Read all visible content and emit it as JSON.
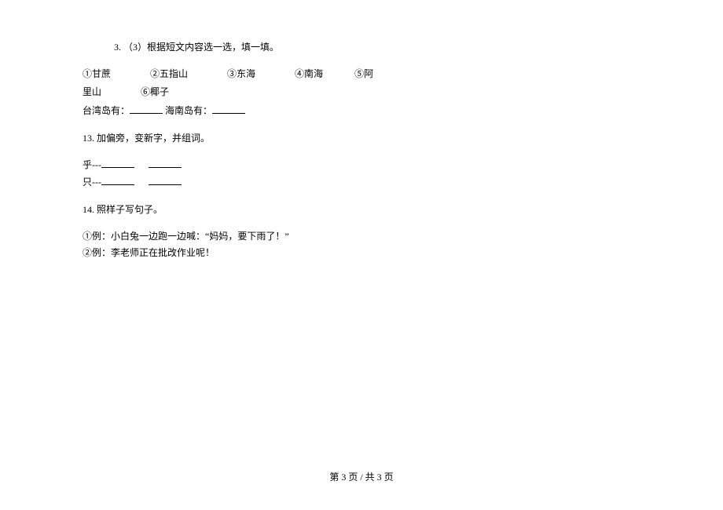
{
  "q3": {
    "number": "3.",
    "label": "（3）根据短文内容选一选，填一填。"
  },
  "options": {
    "line1": {
      "opt1": "①甘蔗",
      "opt2": "②五指山",
      "opt3": "③东海",
      "opt4": "④南海",
      "opt5": "⑤阿"
    },
    "line2": {
      "opt5b": "里山",
      "opt6": "⑥椰子"
    }
  },
  "fill": {
    "taiwan": "台湾岛有：",
    "hainan": " 海南岛有："
  },
  "q13": {
    "number": "13.",
    "text": "加偏旁，变新字，并组词。"
  },
  "q13lines": {
    "line1": "乎---",
    "line2": "只---"
  },
  "q14": {
    "number": "14.",
    "text": "照样子写句子。"
  },
  "q14lines": {
    "ex1": "①例：小白兔一边跑一边喊：“妈妈，要下雨了！”",
    "ex2": "②例：李老师正在批改作业呢！"
  },
  "footer": {
    "text": "第 3 页  /  共 3 页"
  }
}
